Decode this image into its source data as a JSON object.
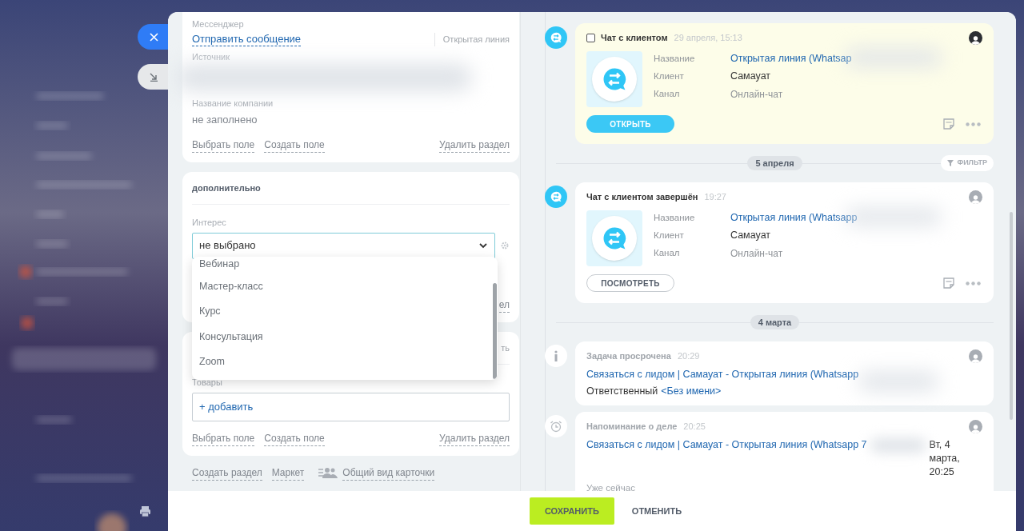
{
  "left": {
    "main_section": {
      "fields": [
        {
          "label": "Мессенджер",
          "value": "Отправить сообщение",
          "extra": "Открытая линия"
        },
        {
          "label": "Источник",
          "redacted": true
        },
        {
          "label": "Название компании",
          "value": "не заполнено"
        }
      ],
      "actions": [
        "Выбрать поле",
        "Создать поле"
      ],
      "delete": "Удалить раздел"
    },
    "extra_section": {
      "title": "дополнительно",
      "field_label": "Интерес",
      "select_value": "не выбрано",
      "delete_partial": "ел",
      "options": [
        "Вебинар",
        "Мастер-класс",
        "Курс",
        "Консультация",
        "Zoom"
      ]
    },
    "products_section": {
      "header_partial": "ть",
      "field_label": "Товары",
      "add": "+ добавить",
      "actions": [
        "Выбрать поле",
        "Создать поле"
      ],
      "delete": "Удалить раздел"
    },
    "bottom_links": [
      "Создать раздел",
      "Маркет",
      "Общий вид карточки"
    ]
  },
  "timeline": [
    {
      "kind": "chat",
      "highlighted": true,
      "checked": false,
      "title": "Чат с клиентом",
      "time": "29 апреля, 15:13",
      "rows": [
        {
          "label": "Название",
          "value": "Открытая линия (Whatsap",
          "link": true
        },
        {
          "label": "Клиент",
          "value": "Самауат",
          "link": false
        },
        {
          "label": "Канал",
          "value": "Онлайн-чат",
          "link": false
        }
      ],
      "button": {
        "label": "ОТКРЫТЬ",
        "kind": "primary"
      },
      "avatar_dark": true
    },
    {
      "kind": "date",
      "label": "5 апреля",
      "filter": "ФИЛЬТР"
    },
    {
      "kind": "chat",
      "highlighted": false,
      "title": "Чат с клиентом завершён",
      "time": "19:27",
      "rows": [
        {
          "label": "Название",
          "value": "Открытая линия (Whatsapp",
          "link": true
        },
        {
          "label": "Клиент",
          "value": "Самауат",
          "link": false
        },
        {
          "label": "Канал",
          "value": "Онлайн-чат",
          "link": false
        }
      ],
      "button": {
        "label": "ПОСМОТРЕТЬ",
        "kind": "outline"
      },
      "avatar_dark": false
    },
    {
      "kind": "date",
      "label": "4 марта"
    },
    {
      "kind": "task",
      "title": "Задача просрочена",
      "time": "20:29",
      "link": "Связаться с лидом | Самауат - Открытая линия (Whatsapp",
      "responsible_label": "Ответственный",
      "responsible": "<Без имени>"
    },
    {
      "kind": "reminder",
      "title": "Напоминание о деле",
      "time": "20:25",
      "link": "Связаться с лидом | Самауат - Открытая линия (Whatsapp 7",
      "date": "Вт, 4 марта, 20:25",
      "note": "Уже сейчас"
    }
  ],
  "footer": {
    "save": "СОХРАНИТЬ",
    "cancel": "ОТМЕНИТЬ"
  }
}
